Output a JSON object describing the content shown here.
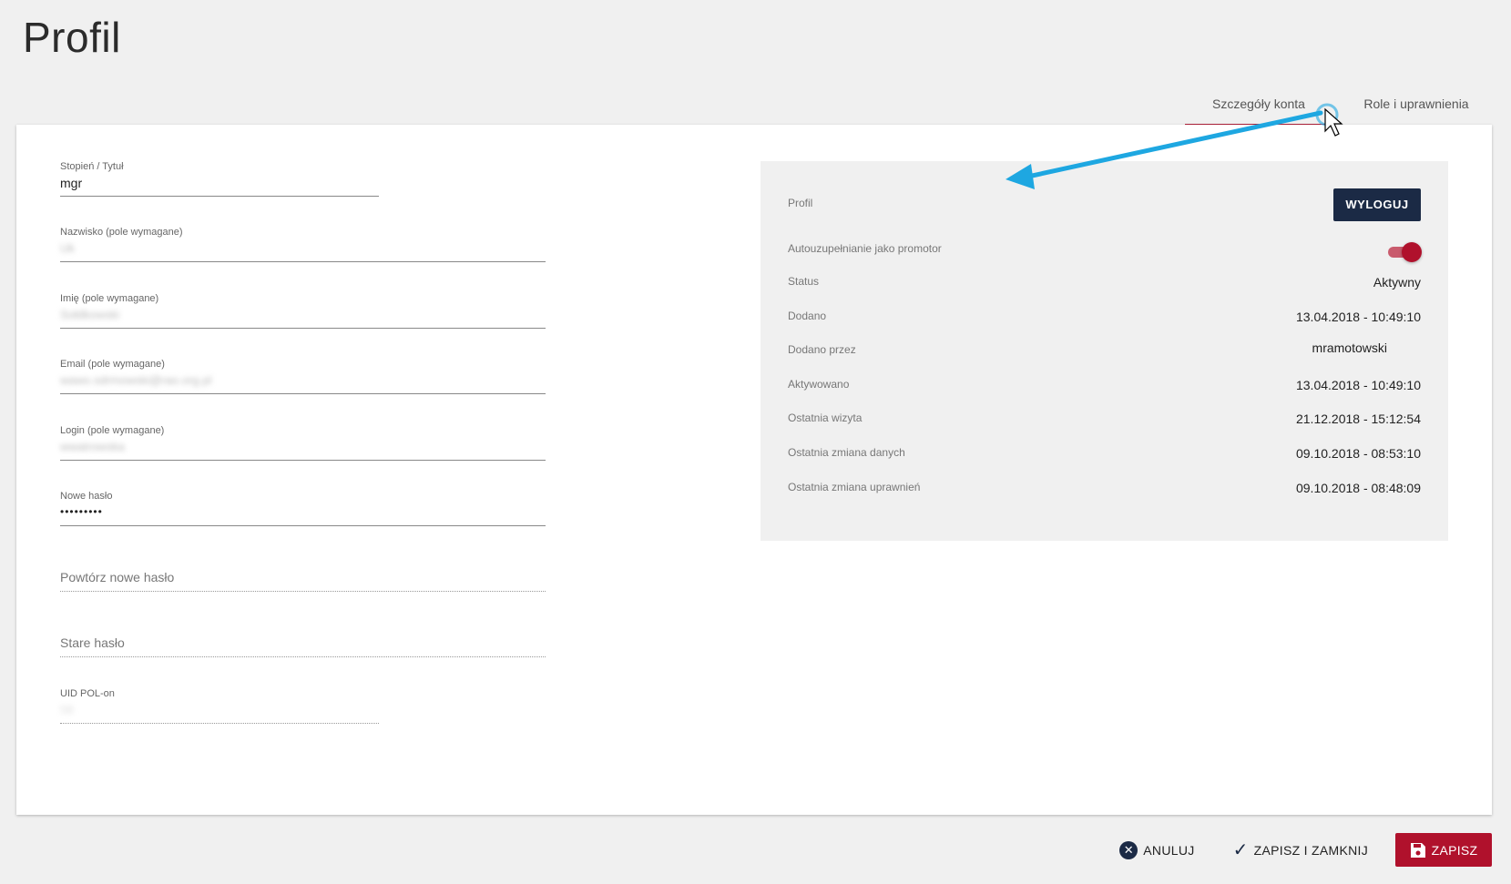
{
  "page": {
    "title": "Profil"
  },
  "tabs": [
    {
      "label": "Szczegóły konta",
      "active": true
    },
    {
      "label": "Role i uprawnienia",
      "active": false
    }
  ],
  "form": {
    "degree": {
      "label": "Stopień / Tytuł",
      "value": "mgr"
    },
    "lastname": {
      "label": "Nazwisko (pole wymagane)",
      "value": "Uk"
    },
    "firstname": {
      "label": "Imię (pole wymagane)",
      "value": "Sołdkowski"
    },
    "email": {
      "label": "Email (pole wymagane)",
      "value": "wawo.sdrmowski@rao.org.pl"
    },
    "login": {
      "label": "Login (pole wymagane)",
      "value": "wwatrowska"
    },
    "new_password": {
      "label": "Nowe hasło",
      "value": "•••••••••"
    },
    "repeat_password": {
      "placeholder": "Powtórz nowe hasło"
    },
    "old_password": {
      "placeholder": "Stare hasło"
    },
    "uid": {
      "label": "UID POL-on",
      "value": "58"
    }
  },
  "info": {
    "profile_label": "Profil",
    "logout_button": "WYLOGUJ",
    "autocomplete_label": "Autouzupełnianie jako promotor",
    "autocomplete_on": true,
    "rows": [
      {
        "label": "Status",
        "value": "Aktywny"
      },
      {
        "label": "Dodano",
        "value": "13.04.2018 - 10:49:10"
      },
      {
        "label": "Dodano przez",
        "value": "mramotowski"
      },
      {
        "label": "Aktywowano",
        "value": "13.04.2018 - 10:49:10"
      },
      {
        "label": "Ostatnia wizyta",
        "value": "21.12.2018 - 15:12:54"
      },
      {
        "label": "Ostatnia zmiana danych",
        "value": "09.10.2018 - 08:53:10"
      },
      {
        "label": "Ostatnia zmiana uprawnień",
        "value": "09.10.2018 - 08:48:09"
      }
    ]
  },
  "footer": {
    "cancel": "ANULUJ",
    "save_close": "ZAPISZ I ZAMKNIJ",
    "save": "ZAPISZ"
  },
  "icons": {
    "cancel": "close-circle-icon",
    "save_close": "check-icon",
    "save": "floppy-disk-icon"
  },
  "colors": {
    "accent": "#b0112c",
    "navy": "#1b2a45",
    "annotation_arrow": "#1ea7e1"
  }
}
